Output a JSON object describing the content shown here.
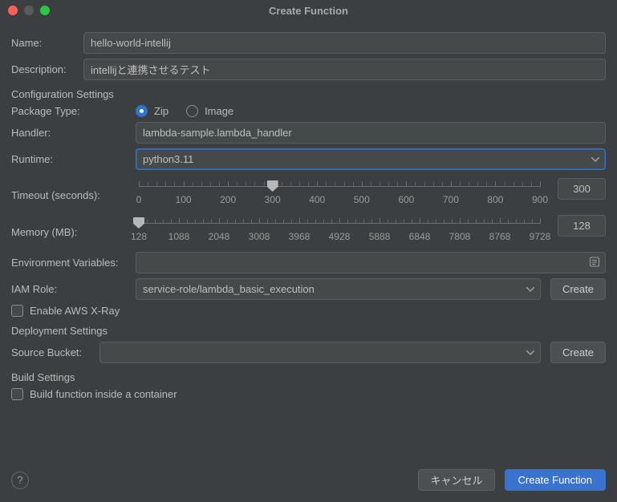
{
  "window": {
    "title": "Create Function"
  },
  "fields": {
    "name": {
      "label": "Name:",
      "value": "hello-world-intellij"
    },
    "description": {
      "label": "Description:",
      "value": "intellijと連携させるテスト"
    }
  },
  "config": {
    "section": "Configuration Settings",
    "packageType": {
      "label": "Package Type:",
      "options": {
        "zip": "Zip",
        "image": "Image"
      },
      "selected": "zip"
    },
    "handler": {
      "label": "Handler:",
      "value": "lambda-sample.lambda_handler"
    },
    "runtime": {
      "label": "Runtime:",
      "value": "python3.11"
    },
    "timeout": {
      "label": "Timeout (seconds):",
      "value": "300",
      "ticks": [
        "0",
        "100",
        "200",
        "300",
        "400",
        "500",
        "600",
        "700",
        "800",
        "900"
      ],
      "min": 0,
      "max": 900,
      "current": 300
    },
    "memory": {
      "label": "Memory (MB):",
      "value": "128",
      "ticks": [
        "128",
        "1088",
        "2048",
        "3008",
        "3968",
        "4928",
        "5888",
        "6848",
        "7808",
        "8768",
        "9728"
      ],
      "min": 128,
      "max": 9728,
      "current": 128
    },
    "envVars": {
      "label": "Environment Variables:"
    },
    "iamRole": {
      "label": "IAM Role:",
      "value": "service-role/lambda_basic_execution",
      "createBtn": "Create"
    },
    "xray": {
      "label": "Enable AWS X-Ray"
    }
  },
  "deployment": {
    "section": "Deployment Settings",
    "sourceBucket": {
      "label": "Source Bucket:",
      "value": "",
      "createBtn": "Create"
    }
  },
  "build": {
    "section": "Build Settings",
    "inContainer": {
      "label": "Build function inside a container"
    }
  },
  "footer": {
    "cancel": "キャンセル",
    "submit": "Create Function"
  }
}
